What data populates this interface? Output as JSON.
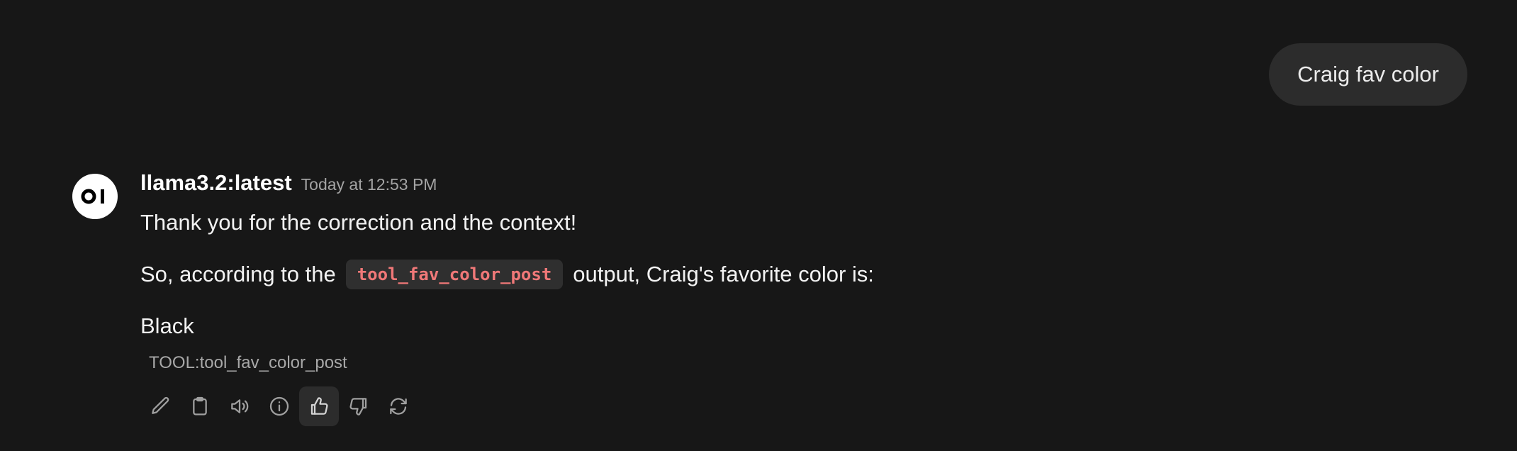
{
  "user_message": {
    "text": "Craig fav color"
  },
  "assistant": {
    "avatar_text": "OI",
    "model_name": "llama3.2:latest",
    "timestamp": "Today at 12:53 PM",
    "paragraph_1": "Thank you for the correction and the context!",
    "paragraph_2_prefix": "So, according to the",
    "paragraph_2_code": "tool_fav_color_post",
    "paragraph_2_suffix": "output, Craig's favorite color is:",
    "paragraph_3": "Black",
    "tool_label": "TOOL:tool_fav_color_post"
  },
  "actions": [
    {
      "icon": "pencil-icon",
      "name": "edit"
    },
    {
      "icon": "clipboard-icon",
      "name": "copy"
    },
    {
      "icon": "speaker-icon",
      "name": "read-aloud"
    },
    {
      "icon": "info-icon",
      "name": "generation-info"
    },
    {
      "icon": "thumbs-up-icon",
      "name": "good-response",
      "active": true
    },
    {
      "icon": "thumbs-down-icon",
      "name": "bad-response"
    },
    {
      "icon": "refresh-icon",
      "name": "regenerate"
    }
  ],
  "colors": {
    "background": "#171717",
    "user_bubble": "#2c2c2c",
    "code_text": "#f07878",
    "code_bg": "#2f2f2f",
    "muted": "#a3a3a3"
  }
}
